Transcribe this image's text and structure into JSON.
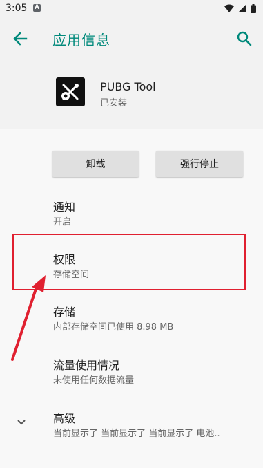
{
  "status_bar": {
    "time": "3:05",
    "notification_icon": "A"
  },
  "app_bar": {
    "title": "应用信息",
    "back_icon": "arrow-back-icon",
    "search_icon": "search-icon",
    "accent_color": "#00897b"
  },
  "app": {
    "name": "PUBG Tool",
    "status": "已安装",
    "icon": "tools-gear-icon"
  },
  "buttons": {
    "uninstall": "卸载",
    "force_stop": "强行停止"
  },
  "settings": [
    {
      "title": "通知",
      "subtitle": "开启"
    },
    {
      "title": "权限",
      "subtitle": "存储空间"
    },
    {
      "title": "存储",
      "subtitle": "内部存储空间已使用 8.98 MB"
    },
    {
      "title": "流量使用情况",
      "subtitle": "未使用任何数据流量"
    },
    {
      "title": "高级",
      "subtitle": "当前显示了 当前显示了 当前显示了 电池.."
    }
  ],
  "annotation": {
    "highlight_color": "#e02030"
  }
}
